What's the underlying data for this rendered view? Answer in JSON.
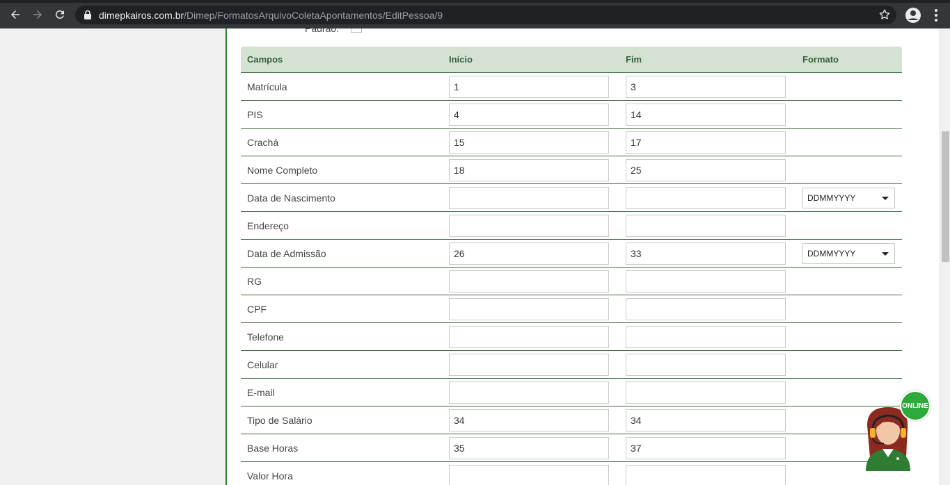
{
  "browser": {
    "url_host": "dimepkairos.com.br",
    "url_path": "/Dimep/FormatosArquivoColetaApontamentos/EditPessoa/9"
  },
  "form": {
    "padrao_label": "Padrão:"
  },
  "table": {
    "headers": {
      "campos": "Campos",
      "inicio": "Início",
      "fim": "Fim",
      "formato": "Formato"
    },
    "rows": [
      {
        "label": "Matrícula",
        "start": "1",
        "end": "3",
        "format": ""
      },
      {
        "label": "PIS",
        "start": "4",
        "end": "14",
        "format": ""
      },
      {
        "label": "Crachá",
        "start": "15",
        "end": "17",
        "format": ""
      },
      {
        "label": "Nome Completo",
        "start": "18",
        "end": "25",
        "format": ""
      },
      {
        "label": "Data de Nascimento",
        "start": "",
        "end": "",
        "format": "DDMMYYYY"
      },
      {
        "label": "Endereço",
        "start": "",
        "end": "",
        "format": ""
      },
      {
        "label": "Data de Admissão",
        "start": "26",
        "end": "33",
        "format": "DDMMYYYY"
      },
      {
        "label": "RG",
        "start": "",
        "end": "",
        "format": ""
      },
      {
        "label": "CPF",
        "start": "",
        "end": "",
        "format": ""
      },
      {
        "label": "Telefone",
        "start": "",
        "end": "",
        "format": ""
      },
      {
        "label": "Celular",
        "start": "",
        "end": "",
        "format": ""
      },
      {
        "label": "E-mail",
        "start": "",
        "end": "",
        "format": ""
      },
      {
        "label": "Tipo de Salário",
        "start": "34",
        "end": "34",
        "format": ""
      },
      {
        "label": "Base Horas",
        "start": "35",
        "end": "37",
        "format": ""
      },
      {
        "label": "Valor Hora",
        "start": "",
        "end": "",
        "format": ""
      }
    ]
  },
  "support_widget": {
    "status_label": "ONLINE",
    "colors": {
      "badge": "#2eaa3a",
      "uniform": "#2e7d32"
    }
  },
  "colors": {
    "accent": "#2e7d32",
    "header_bg": "#d3e2d3",
    "header_text": "#3a5f3a",
    "chrome_bg": "#35363a"
  }
}
